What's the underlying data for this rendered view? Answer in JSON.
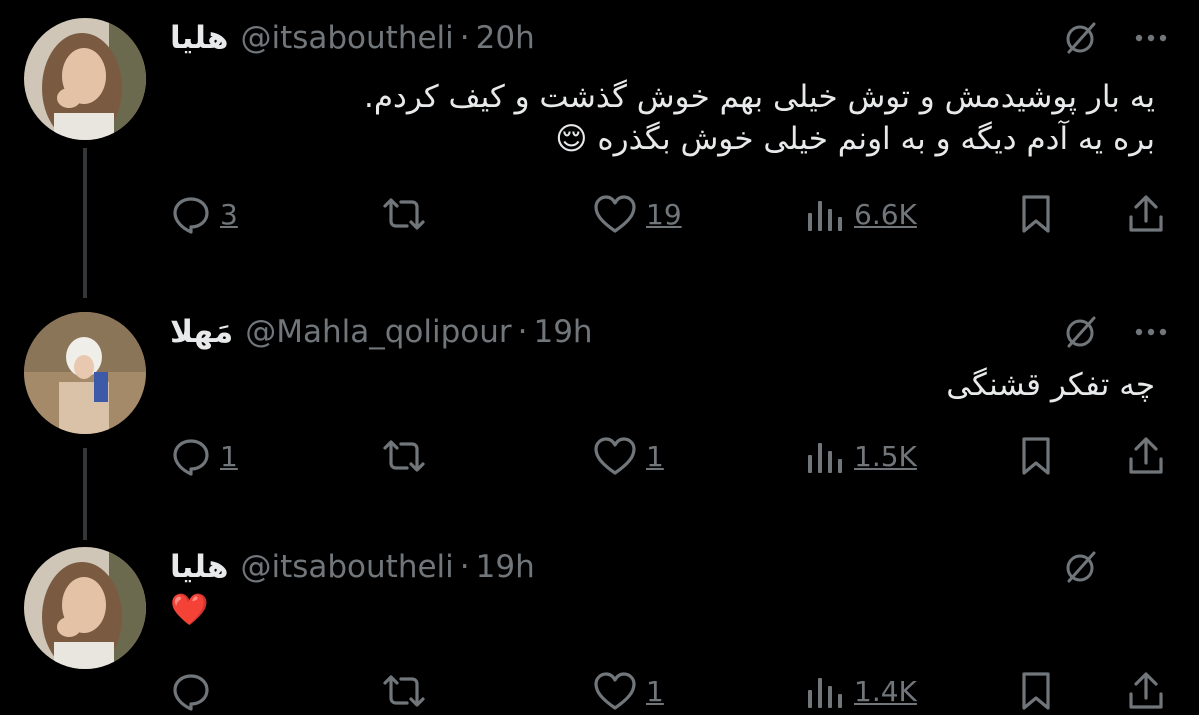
{
  "tweets": [
    {
      "name": "هلیا",
      "handle": "@itsaboutheli",
      "separator": "·",
      "time": "20h",
      "text_lines": [
        "یه بار پوشیدمش و توش خیلی بهم خوش گذشت و کیف کردم.",
        "بره یه آدم دیگه و به اونم خیلی خوش بگذره 😌"
      ],
      "replies": "3",
      "retweets": "",
      "likes": "19",
      "views": "6.6K",
      "show_more": true
    },
    {
      "name": "مَهلا",
      "handle": "@Mahla_qolipour",
      "separator": "·",
      "time": "19h",
      "text_lines": [
        "چه تفکر قشنگی"
      ],
      "replies": "1",
      "retweets": "",
      "likes": "1",
      "views": "1.5K",
      "show_more": true
    },
    {
      "name": "هلیا",
      "handle": "@itsaboutheli",
      "separator": "·",
      "time": "19h",
      "text_lines": [
        "❤️"
      ],
      "replies": "",
      "retweets": "",
      "likes": "1",
      "views": "1.4K",
      "show_more": false
    }
  ],
  "icons": {
    "more": "more-dots-icon",
    "grok": "grok-icon",
    "reply": "reply-icon",
    "retweet": "retweet-icon",
    "like": "heart-icon",
    "views": "views-icon",
    "bookmark": "bookmark-icon",
    "share": "share-icon"
  },
  "colors": {
    "background": "#000000",
    "text": "#e7e9ea",
    "secondary": "#71767b",
    "thread_line": "#333639"
  }
}
